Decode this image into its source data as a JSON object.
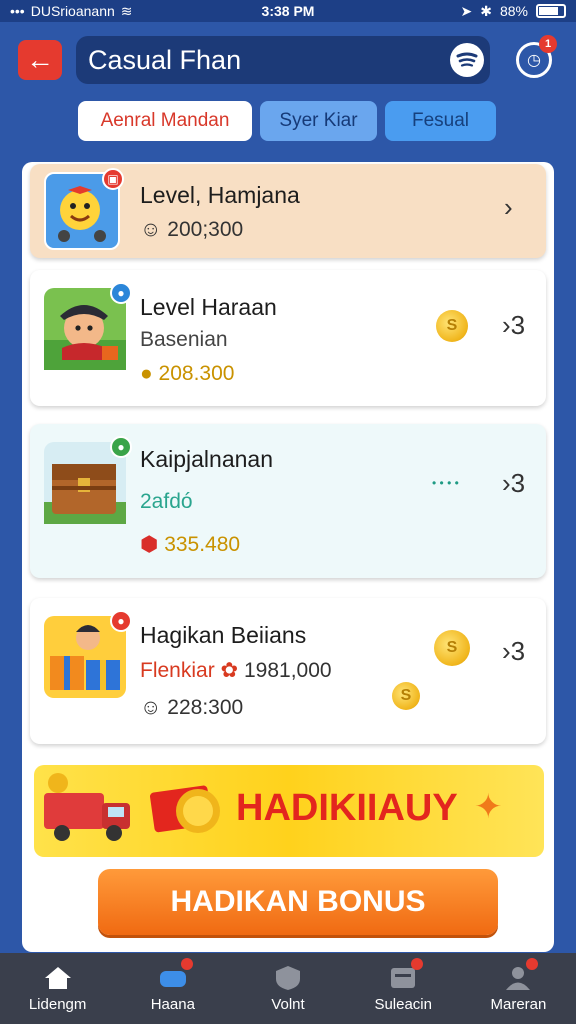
{
  "status_bar": {
    "carrier": "DUSrioanann",
    "time": "3:38 PM",
    "battery": "88%"
  },
  "header": {
    "title": "Casual Fhan",
    "notification_count": "1"
  },
  "tabs": [
    {
      "label": "Aenral Mandan"
    },
    {
      "label": "Syer Kiar"
    },
    {
      "label": "Fesual"
    }
  ],
  "cards": [
    {
      "title": "Level, Hamjana",
      "line1": "200;300"
    },
    {
      "title": "Level Haraan",
      "line1": "Basenian",
      "line2": "208.300"
    },
    {
      "title": "Kaipjalnanan",
      "line1": "2afdó",
      "dots": "• • • •",
      "line2": "335.480"
    },
    {
      "title": "Hagikan Beiians",
      "line1_label": "Flenkiar",
      "line1_value": "1981,000",
      "line2": "228:300"
    }
  ],
  "banner": {
    "text": "HADIKIIAUY"
  },
  "bonus_button": {
    "label": "HADIKAN BONUS"
  },
  "bottom_nav": [
    {
      "label": "Lidengm"
    },
    {
      "label": "Haana"
    },
    {
      "label": "Volnt"
    },
    {
      "label": "Suleacin"
    },
    {
      "label": "Mareran"
    }
  ],
  "colors": {
    "background": "#2d57a8",
    "accent_red": "#e53a2f",
    "coin": "#f0b51b",
    "bonus_orange": "#f06a12",
    "banner_yellow": "#ffd21c"
  }
}
